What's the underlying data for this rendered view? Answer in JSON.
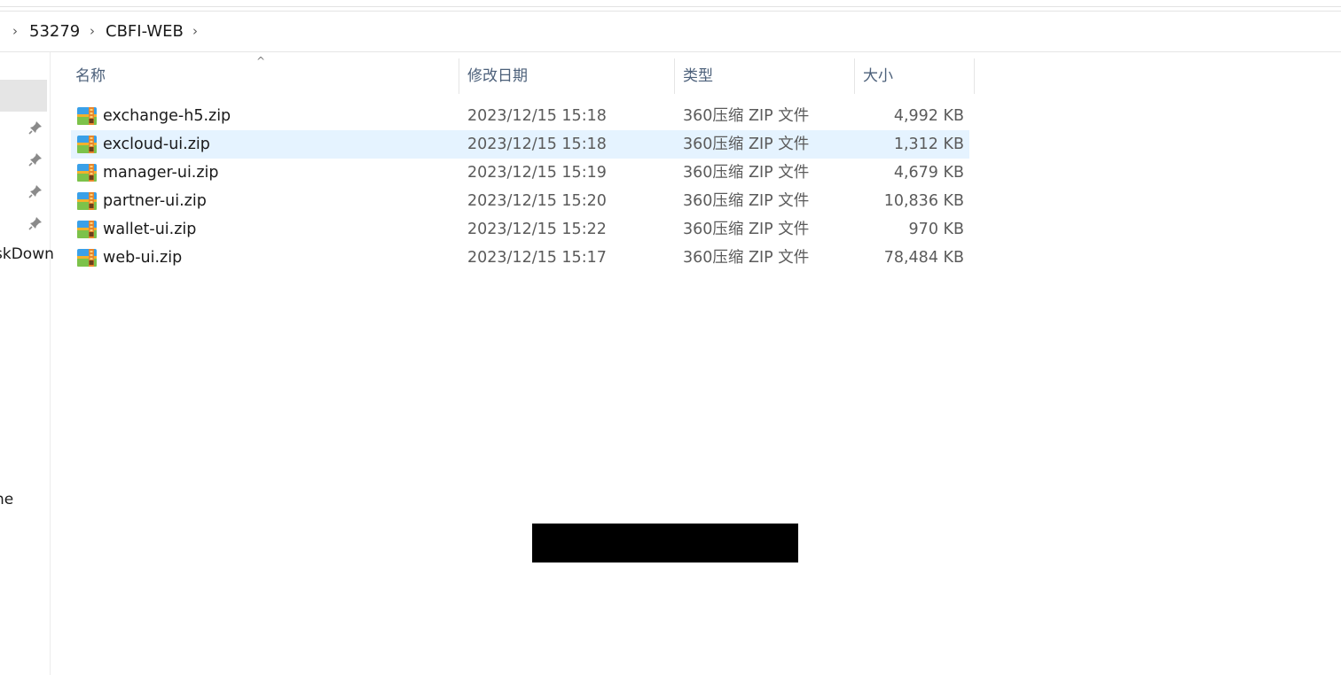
{
  "breadcrumb": {
    "items": [
      "53279",
      "CBFI-WEB"
    ]
  },
  "sidebar": {
    "truncated_item_1": "skDown",
    "truncated_item_2": "ne"
  },
  "columns": {
    "name": "名称",
    "modified": "修改日期",
    "type": "类型",
    "size": "大小"
  },
  "files": [
    {
      "name": "exchange-h5.zip",
      "modified": "2023/12/15 15:18",
      "type": "360压缩 ZIP 文件",
      "size": "4,992 KB",
      "selected": false
    },
    {
      "name": "excloud-ui.zip",
      "modified": "2023/12/15 15:18",
      "type": "360压缩 ZIP 文件",
      "size": "1,312 KB",
      "selected": true
    },
    {
      "name": "manager-ui.zip",
      "modified": "2023/12/15 15:19",
      "type": "360压缩 ZIP 文件",
      "size": "4,679 KB",
      "selected": false
    },
    {
      "name": "partner-ui.zip",
      "modified": "2023/12/15 15:20",
      "type": "360压缩 ZIP 文件",
      "size": "10,836 KB",
      "selected": false
    },
    {
      "name": "wallet-ui.zip",
      "modified": "2023/12/15 15:22",
      "type": "360压缩 ZIP 文件",
      "size": "970 KB",
      "selected": false
    },
    {
      "name": "web-ui.zip",
      "modified": "2023/12/15 15:17",
      "type": "360压缩 ZIP 文件",
      "size": "78,484 KB",
      "selected": false
    }
  ],
  "colors": {
    "selection": "#e5f3ff",
    "header_text": "#4c607a"
  }
}
